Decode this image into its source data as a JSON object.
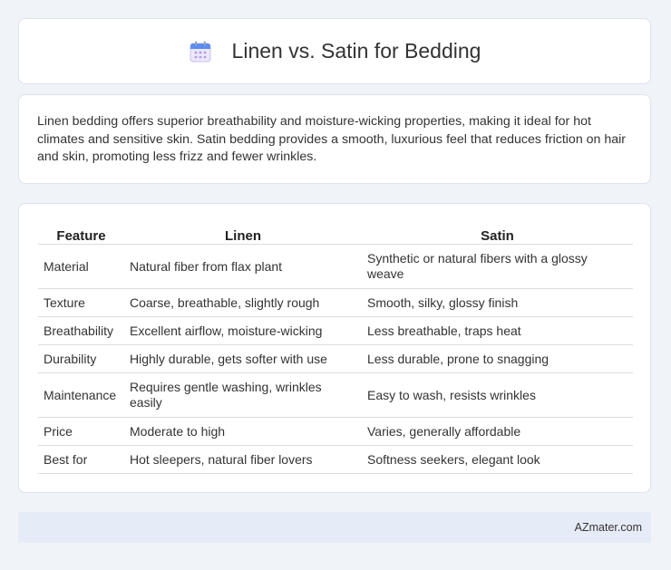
{
  "header": {
    "title": "Linen vs. Satin for Bedding",
    "icon": "calendar-icon"
  },
  "summary": "Linen bedding offers superior breathability and moisture-wicking properties, making it ideal for hot climates and sensitive skin. Satin bedding provides a smooth, luxurious feel that reduces friction on hair and skin, promoting less frizz and fewer wrinkles.",
  "table": {
    "headers": [
      "Feature",
      "Linen",
      "Satin"
    ],
    "rows": [
      [
        "Material",
        "Natural fiber from flax plant",
        "Synthetic or natural fibers with a glossy weave"
      ],
      [
        "Texture",
        "Coarse, breathable, slightly rough",
        "Smooth, silky, glossy finish"
      ],
      [
        "Breathability",
        "Excellent airflow, moisture-wicking",
        "Less breathable, traps heat"
      ],
      [
        "Durability",
        "Highly durable, gets softer with use",
        "Less durable, prone to snagging"
      ],
      [
        "Maintenance",
        "Requires gentle washing, wrinkles easily",
        "Easy to wash, resists wrinkles"
      ],
      [
        "Price",
        "Moderate to high",
        "Varies, generally affordable"
      ],
      [
        "Best for",
        "Hot sleepers, natural fiber lovers",
        "Softness seekers, elegant look"
      ]
    ]
  },
  "footer": {
    "brand": "AZmater.com"
  }
}
